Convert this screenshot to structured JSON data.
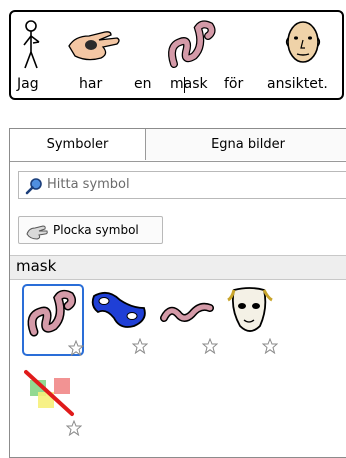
{
  "sentence": {
    "words": [
      "Jag",
      "har",
      "en",
      "mask",
      "för",
      "ansiktet."
    ]
  },
  "panel": {
    "tabs": [
      "Symboler",
      "Egna bilder"
    ],
    "search_placeholder": "Hitta symbol",
    "pick_button_label": "Plocka symbol",
    "result_header": "mask",
    "results": [
      {
        "icon": "worm-icon",
        "selected": true
      },
      {
        "icon": "eye-mask-icon",
        "selected": false
      },
      {
        "icon": "worm-icon",
        "selected": false
      },
      {
        "icon": "theatre-mask-icon",
        "selected": false
      },
      {
        "icon": "no-symbol-icon",
        "selected": false
      }
    ]
  },
  "colors": {
    "selection": "#2a6ed8",
    "mask_blue": "#1f3fd6",
    "worm_pink": "#d49aa8"
  }
}
